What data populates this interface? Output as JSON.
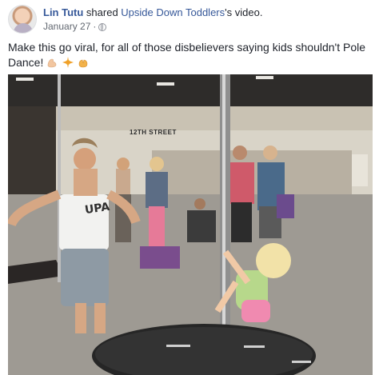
{
  "post": {
    "author": "Lin Tutu",
    "action": "shared",
    "source_page": "Upside Down Toddlers",
    "source_suffix": "'s video.",
    "date": "January 27",
    "separator": "·",
    "privacy_icon": "globe-icon",
    "text": "Make this go viral, for all of those disbelievers saying kids shouldn't Pole Dance!",
    "emojis": [
      "flexed-biceps-emoji",
      "sparkle-burst-emoji",
      "raising-hands-emoji"
    ]
  },
  "video": {
    "sign_text": "12TH STREET",
    "shirt_text": "UPA"
  },
  "colors": {
    "link": "#365899",
    "text": "#1d2129",
    "meta": "#616770"
  }
}
